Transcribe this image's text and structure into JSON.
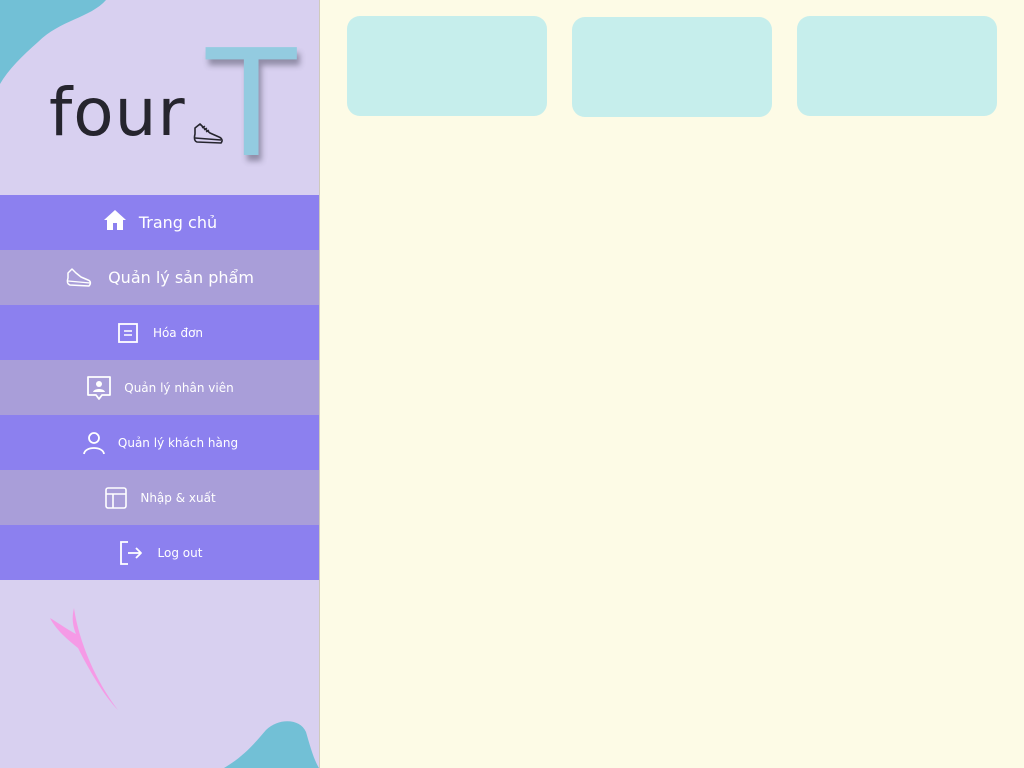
{
  "logo": {
    "text": "four",
    "letter": "T"
  },
  "menu": {
    "items": [
      {
        "label": "Trang chủ",
        "icon": "home-icon"
      },
      {
        "label": "Quản lý sản phẩm",
        "icon": "sneaker-icon"
      },
      {
        "label": "Hóa đơn",
        "icon": "invoice-icon"
      },
      {
        "label": "Quản lý nhân viên",
        "icon": "employee-badge-icon"
      },
      {
        "label": "Quản lý khách hàng",
        "icon": "user-icon"
      },
      {
        "label": "Nhập & xuất",
        "icon": "layout-panel-icon"
      },
      {
        "label": "Log out",
        "icon": "logout-icon"
      }
    ]
  },
  "colors": {
    "sidebar_bg": "#d8d0f0",
    "menu_dark": "#8c80ef",
    "menu_light": "#a99ed9",
    "content_bg": "#fdfbe6",
    "card_bg": "#c6eeec",
    "blob_teal": "#72c0d6",
    "accent_pink": "#f59ae6",
    "logo_t": "#93cbe0"
  },
  "cards": [
    {},
    {},
    {}
  ]
}
